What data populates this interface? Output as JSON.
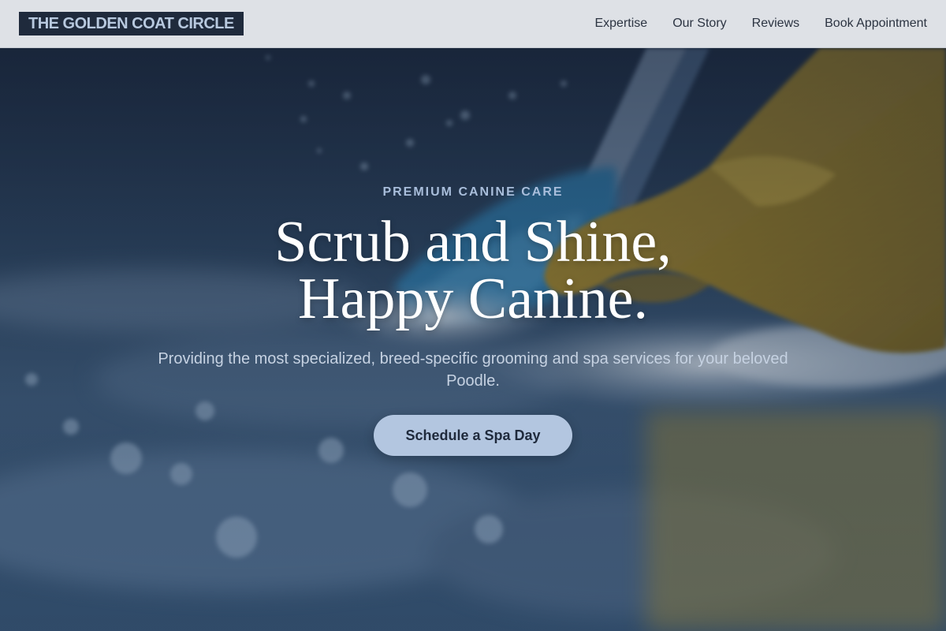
{
  "brand": {
    "logo_text": "THE GOLDEN COAT CIRCLE"
  },
  "nav": {
    "items": [
      {
        "label": "Expertise"
      },
      {
        "label": "Our Story"
      },
      {
        "label": "Reviews"
      },
      {
        "label": "Book Appointment"
      }
    ]
  },
  "hero": {
    "eyebrow": "PREMIUM CANINE CARE",
    "headline_line1": "Scrub and Shine,",
    "headline_line2": "Happy Canine.",
    "subtext": "Providing the most specialized, breed-specific grooming and spa services for your beloved Poodle.",
    "cta_label": "Schedule a Spa Day",
    "background_image": "gloved-hand-scrubbing-wet-surface-with-blue-sponge"
  },
  "colors": {
    "nav_bg": "#dee1e6",
    "logo_bg": "#1f2a3c",
    "logo_text": "#b8c9df",
    "accent": "#b3c6e0",
    "eyebrow": "#a9bedb"
  }
}
